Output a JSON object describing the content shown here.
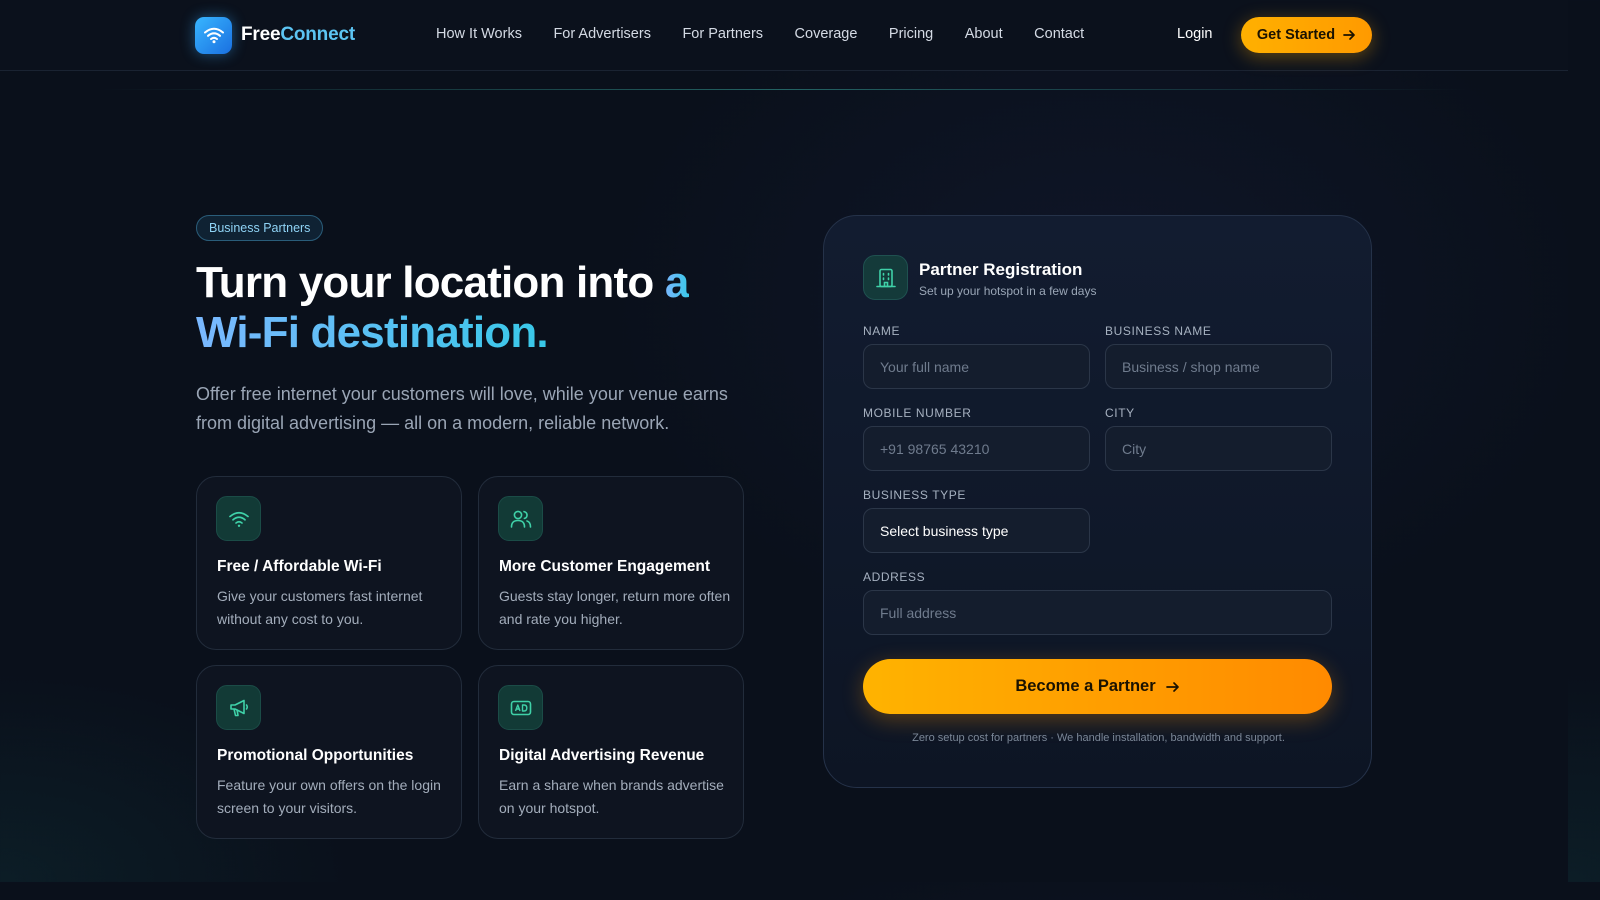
{
  "header": {
    "brand_part1": "Free",
    "brand_part2": "Connect",
    "nav": [
      "How It Works",
      "For Advertisers",
      "For Partners",
      "Coverage",
      "Pricing",
      "About",
      "Contact"
    ],
    "login": "Login",
    "cta": "Get Started"
  },
  "hero": {
    "badge": "Business Partners",
    "headline_plain": "Turn your location into ",
    "headline_highlight_1": "a",
    "headline_highlight_2": "Wi-Fi destination.",
    "subcopy": "Offer free internet your customers will love, while your venue earns from digital advertising — all on a modern, reliable network."
  },
  "features": [
    {
      "icon": "wifi-icon",
      "title": "Free / Affordable Wi-Fi",
      "desc": "Give your customers fast internet without any cost to you."
    },
    {
      "icon": "users-icon",
      "title": "More Customer Engagement",
      "desc": "Guests stay longer, return more often and rate you higher."
    },
    {
      "icon": "megaphone-icon",
      "title": "Promotional Opportunities",
      "desc": "Feature your own offers on the login screen to your visitors."
    },
    {
      "icon": "ad-icon",
      "title": "Digital Advertising Revenue",
      "desc": "Earn a share when brands advertise on your hotspot."
    }
  ],
  "form": {
    "icon": "building-icon",
    "title": "Partner Registration",
    "subtitle": "Set up your hotspot in a few days",
    "name_label": "NAME",
    "name_placeholder": "Your full name",
    "business_label": "BUSINESS NAME",
    "business_placeholder": "Business / shop name",
    "mobile_label": "MOBILE NUMBER",
    "mobile_placeholder": "+91 98765 43210",
    "city_label": "CITY",
    "city_placeholder": "City",
    "type_label": "BUSINESS TYPE",
    "type_value": "Select business type",
    "address_label": "ADDRESS",
    "address_placeholder": "Full address",
    "submit": "Become a Partner",
    "note": "Zero setup cost for partners · We handle installation, bandwidth and support."
  },
  "colors": {
    "background": "#0a101b",
    "accent_orange": "#ffb000",
    "accent_blue": "#5cc4f2",
    "accent_teal": "#3fd1a8"
  }
}
